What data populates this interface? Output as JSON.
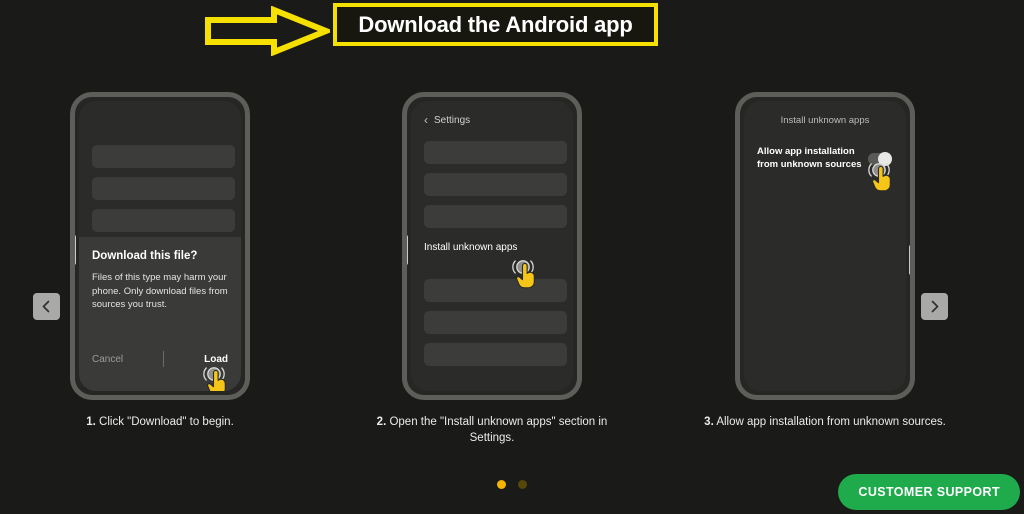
{
  "header": {
    "title": "Download the Android app",
    "arrow_icon": "arrow-right-outline-icon",
    "accent_color": "#f5e000"
  },
  "carousel": {
    "prev_label": "‹",
    "next_label": "›",
    "prev_icon": "chevron-left-icon",
    "next_icon": "chevron-right-icon",
    "dots": [
      {
        "state": "active"
      },
      {
        "state": "inactive"
      }
    ],
    "dot_active_color": "#f5b400",
    "dot_inactive_color": "#564808",
    "slides": [
      {
        "id": "slide-download-file",
        "caption_number": "1.",
        "caption_text": "Click \"Download\" to begin.",
        "dialog": {
          "title": "Download this file?",
          "body": "Files of this type may harm your phone. Only download files from sources you trust.",
          "cancel_label": "Cancel",
          "confirm_label": "Load"
        },
        "tap_target": "load-button"
      },
      {
        "id": "slide-settings",
        "caption_number": "2.",
        "caption_text": "Open the \"Install unknown apps\" section in Settings.",
        "screen_title": "Settings",
        "back_icon": "chevron-left-icon",
        "row_label": "Install unknown apps",
        "tap_target": "install-unknown-apps-row"
      },
      {
        "id": "slide-allow-install",
        "caption_number": "3.",
        "caption_text": "Allow app installation from unknown sources.",
        "screen_title": "Install unknown apps",
        "setting_label": "Allow app installation from unknown sources",
        "toggle_state": "on",
        "tap_target": "allow-install-toggle"
      }
    ]
  },
  "support": {
    "label": "CUSTOMER SUPPORT",
    "color": "#1faa4b"
  }
}
